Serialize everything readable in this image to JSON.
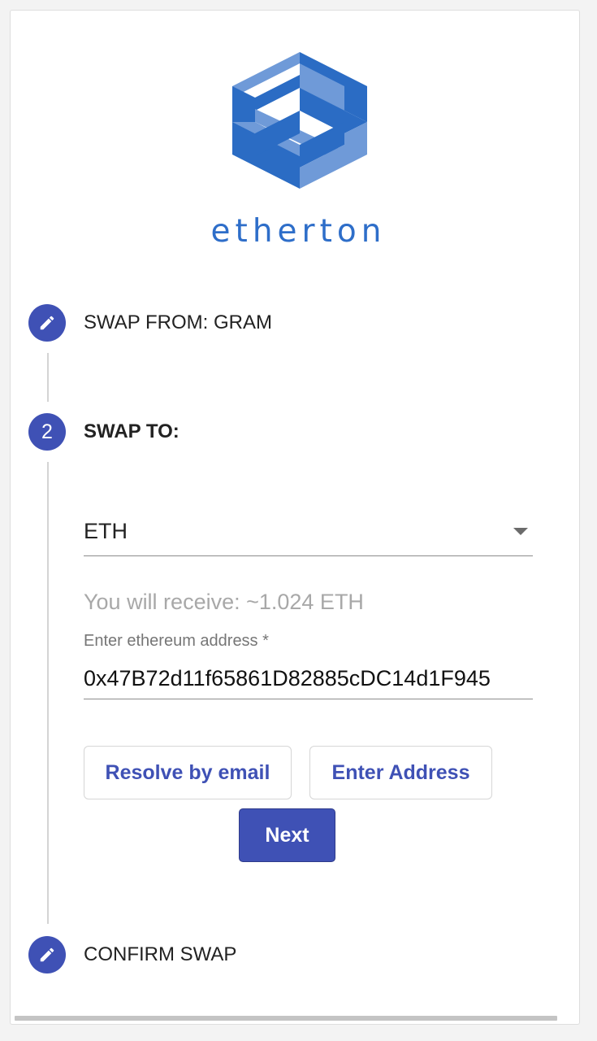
{
  "brand": {
    "name": "etherton",
    "logo_icon": "etherton-logo-icon",
    "color": "#2e6ec9"
  },
  "colors": {
    "accent": "#3f51b5",
    "muted_text": "#a8a8a8"
  },
  "steps": [
    {
      "label": "SWAP FROM: GRAM",
      "icon": "pencil-icon",
      "state": "completed"
    },
    {
      "label": "SWAP TO:",
      "number": "2",
      "state": "active"
    },
    {
      "label": "CONFIRM SWAP",
      "icon": "pencil-icon",
      "state": "inactive"
    }
  ],
  "swap_to": {
    "currency_selected": "ETH",
    "dropdown_icon": "dropdown-arrow-icon",
    "receive_text": "You will receive: ~1.024 ETH",
    "address_label": "Enter ethereum address *",
    "address_value": "0x47B72d11f65861D82885cDC14d1F945",
    "buttons": {
      "resolve_email": "Resolve by email",
      "enter_address": "Enter Address",
      "next": "Next"
    }
  }
}
